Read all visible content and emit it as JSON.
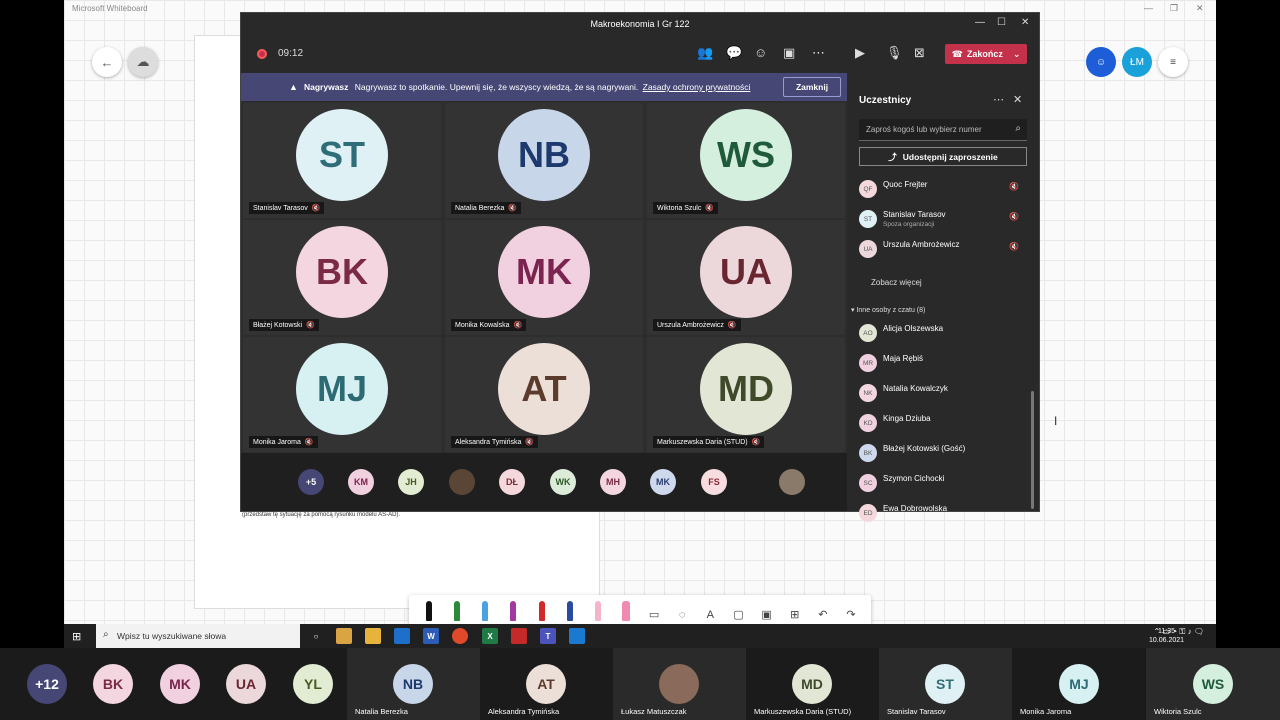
{
  "whiteboard": {
    "app_title": "Microsoft Whiteboard",
    "note_text": "(przedstaw tę sytuację za pomocą rysunku modelu AS-AD).",
    "right_avatars": [
      {
        "initials": "",
        "color": "#1e5dd8"
      },
      {
        "initials": "ŁM",
        "color": "#1ba1d9"
      }
    ]
  },
  "teams": {
    "window_title": "Makroekonomia I Gr 122",
    "timer": "09:12",
    "end_button_label": "Zakończ",
    "recording_banner": {
      "bold": "Nagrywasz",
      "message": "Nagrywasz to spotkanie. Upewnij się, że wszyscy wiedzą, że są nagrywani.",
      "link": "Zasady ochrony prywatności",
      "close_label": "Zamknij"
    },
    "tiles": [
      {
        "initials": "ST",
        "name": "Stanislav Tarasov",
        "bg": "#dff1f4",
        "fg": "#2f6d78"
      },
      {
        "initials": "NB",
        "name": "Natalia Berezka",
        "bg": "#c8d6ea",
        "fg": "#1d3a6e"
      },
      {
        "initials": "WS",
        "name": "Wiktoria Szulc",
        "bg": "#d5efdf",
        "fg": "#1f5a3a"
      },
      {
        "initials": "BK",
        "name": "Błażej Kotowski",
        "bg": "#f3d6df",
        "fg": "#7a2a45"
      },
      {
        "initials": "MK",
        "name": "Monika Kowalska",
        "bg": "#f1d0df",
        "fg": "#7c2450"
      },
      {
        "initials": "UA",
        "name": "Urszula Ambrożewicz",
        "bg": "#ecd7db",
        "fg": "#6a2630"
      },
      {
        "initials": "MJ",
        "name": "Monika Jaroma",
        "bg": "#d7f0f2",
        "fg": "#2d6b74"
      },
      {
        "initials": "AT",
        "name": "Aleksandra Tymińska",
        "bg": "#ecdfd8",
        "fg": "#5b3c2c"
      },
      {
        "initials": "MD",
        "name": "Markuszewska Daria (STUD)",
        "bg": "#e2e6d5",
        "fg": "#3f4a2a"
      }
    ],
    "strip": [
      {
        "initials": "+5",
        "bg": "#464775",
        "fg": "#ffffff"
      },
      {
        "initials": "KM",
        "bg": "#f1d0df",
        "fg": "#7c2450"
      },
      {
        "initials": "JH",
        "bg": "#e2ecd2",
        "fg": "#4a5a22"
      },
      {
        "initials": "",
        "bg": "#5a4636",
        "fg": "#ffffff"
      },
      {
        "initials": "DŁ",
        "bg": "#f4d8dc",
        "fg": "#7a2a35"
      },
      {
        "initials": "WK",
        "bg": "#dcecd9",
        "fg": "#2e5a2a"
      },
      {
        "initials": "MH",
        "bg": "#f3d6df",
        "fg": "#7a2a45"
      },
      {
        "initials": "MK",
        "bg": "#cfd9ee",
        "fg": "#2a3f70"
      },
      {
        "initials": "FS",
        "bg": "#f7dde0",
        "fg": "#8a2a35"
      },
      {
        "initials": "",
        "bg": "#8a7a6a",
        "fg": "#ffffff"
      }
    ],
    "panel": {
      "title": "Uczestnicy",
      "invite_placeholder": "Zaproś kogoś lub wybierz numer",
      "share_label": "Udostępnij zaproszenie",
      "in_meeting": [
        {
          "initials": "QF",
          "name": "Quoc Frejter",
          "sub": ""
        },
        {
          "initials": "ST",
          "name": "Stanislav Tarasov",
          "sub": "Spoza organizacji"
        },
        {
          "initials": "UA",
          "name": "Urszula Ambrożewicz",
          "sub": ""
        }
      ],
      "see_more": "Zobacz więcej",
      "others_heading": "Inne osoby z czatu (8)",
      "others": [
        {
          "initials": "AO",
          "name": "Alicja Olszewska"
        },
        {
          "initials": "MR",
          "name": "Maja Rębiś"
        },
        {
          "initials": "NK",
          "name": "Natalia Kowalczyk"
        },
        {
          "initials": "KD",
          "name": "Kinga Dziuba"
        },
        {
          "initials": "BK",
          "name": "Błażej Kotowski (Gość)"
        },
        {
          "initials": "SC",
          "name": "Szymon Cichocki"
        },
        {
          "initials": "ED",
          "name": "Ewa Dobrowolska"
        }
      ]
    }
  },
  "taskbar": {
    "search_placeholder": "Wpisz tu wyszukiwane słowa",
    "time": "11:35",
    "date": "10.06.2021"
  },
  "gallery": [
    {
      "initials": "+12",
      "name": "",
      "bg": "#464775",
      "fg": "#ffffff"
    },
    {
      "initials": "BK",
      "name": "",
      "bg": "#f3d6df",
      "fg": "#7a2a45"
    },
    {
      "initials": "MK",
      "name": "",
      "bg": "#f1d0df",
      "fg": "#7c2450"
    },
    {
      "initials": "UA",
      "name": "",
      "bg": "#ecd7db",
      "fg": "#6a2630"
    },
    {
      "initials": "YL",
      "name": "",
      "bg": "#e2ecd2",
      "fg": "#4a5a22"
    },
    {
      "initials": "NB",
      "name": "Natalia Berezka",
      "bg": "#c8d6ea",
      "fg": "#1d3a6e"
    },
    {
      "initials": "AT",
      "name": "Aleksandra Tymińska",
      "bg": "#ecdfd8",
      "fg": "#5b3c2c"
    },
    {
      "initials": "",
      "name": "Łukasz Matuszczak",
      "bg": "#8a6a5a",
      "fg": "#ffffff"
    },
    {
      "initials": "MD",
      "name": "Markuszewska Daria (STUD)",
      "bg": "#e2e6d5",
      "fg": "#3f4a2a"
    },
    {
      "initials": "ST",
      "name": "Stanislav Tarasov",
      "bg": "#dff1f4",
      "fg": "#2f6d78"
    },
    {
      "initials": "MJ",
      "name": "Monika Jaroma",
      "bg": "#d7f0f2",
      "fg": "#2d6b74"
    },
    {
      "initials": "WS",
      "name": "Wiktoria Szulc",
      "bg": "#d5efdf",
      "fg": "#1f5a3a"
    }
  ]
}
